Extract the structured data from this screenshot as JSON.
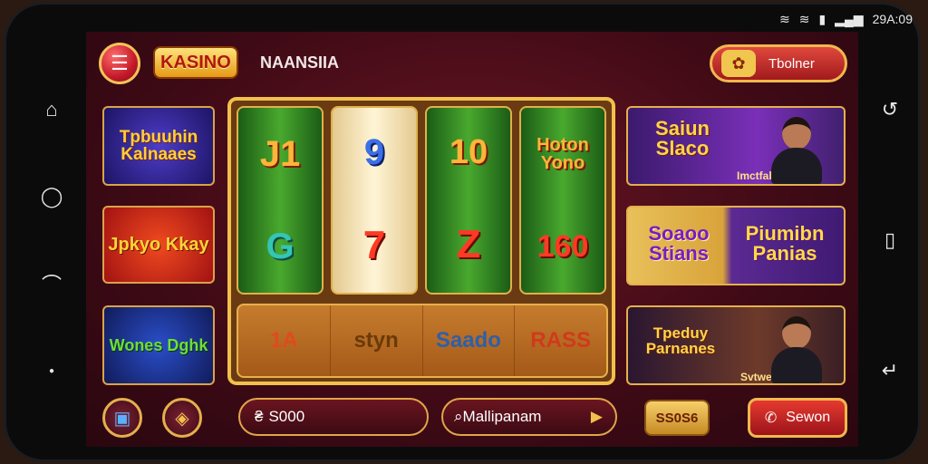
{
  "statusbar": {
    "wifi_icon": "wifi-icon",
    "signal_icon": "signal-icon",
    "battery_icon": "battery-icon",
    "time": "29A:09"
  },
  "header": {
    "logo_text": "KASINO",
    "brand_name": "NAANSIIA",
    "top_button_label": "Tbolner"
  },
  "left_tiles": [
    {
      "title": "Tpbuuhin Kalnaaes"
    },
    {
      "title": "Jpkyo Kkay"
    },
    {
      "title": "Wones Dghk"
    }
  ],
  "reels": [
    {
      "top": "J1",
      "bottom": "G"
    },
    {
      "top": "9",
      "bottom": "7"
    },
    {
      "top": "10",
      "bottom": "Z"
    },
    {
      "top": "Hoton Yono",
      "bottom": "160"
    }
  ],
  "strip": [
    "1A",
    "styn",
    "Saado",
    "RASS"
  ],
  "right_tiles": [
    {
      "title": "Saiun Slaco",
      "subtitle": "Imctfabniiann"
    },
    {
      "title": "Soaoo Stians",
      "title2": "Piumibn Panias"
    },
    {
      "title": "Tpeduy Parnanes",
      "subtitle": "Svtweulan"
    }
  ],
  "bottombar": {
    "balance": "S000",
    "multi_label": "Mallipanam",
    "small_pill": "SS0S6",
    "call_label": "Sewon"
  }
}
